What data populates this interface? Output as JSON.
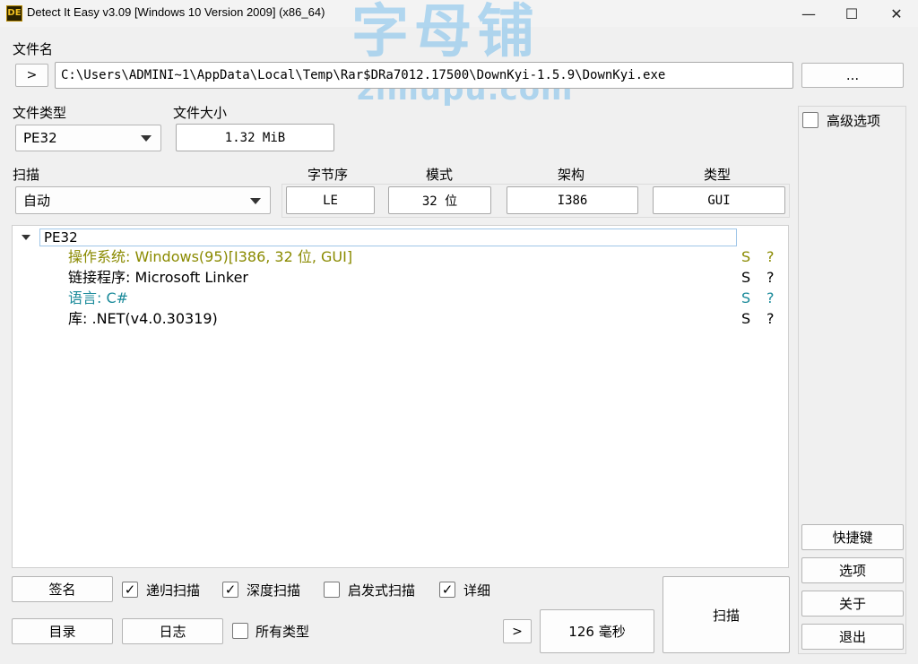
{
  "window": {
    "title": "Detect It Easy v3.09 [Windows 10 Version 2009] (x86_64)",
    "app_icon_text": "DE",
    "minimize_glyph": "—",
    "maximize_glyph": "☐",
    "close_glyph": "✕"
  },
  "watermark": {
    "line1": "字母铺",
    "line2": "zimupu.com"
  },
  "file": {
    "label": "文件名",
    "expand_glyph": ">",
    "path": "C:\\Users\\ADMINI~1\\AppData\\Local\\Temp\\Rar$DRa7012.17500\\DownKyi-1.5.9\\DownKyi.exe",
    "browse_label": "..."
  },
  "filetype": {
    "label": "文件类型",
    "value": "PE32"
  },
  "filesize": {
    "label": "文件大小",
    "value": "1.32 MiB"
  },
  "scan": {
    "label": "扫描",
    "value": "自动"
  },
  "info": {
    "endian_label": "字节序",
    "endian_value": "LE",
    "mode_label": "模式",
    "mode_value": "32 位",
    "arch_label": "架构",
    "arch_value": "I386",
    "type_label": "类型",
    "type_value": "GUI"
  },
  "advanced": {
    "label": "高级选项",
    "checked": false
  },
  "result": {
    "root": "PE32",
    "rows": [
      {
        "text": "操作系统: Windows(95)[I386, 32 位, GUI]",
        "s": "S",
        "q": "?",
        "color": "#8a8a00"
      },
      {
        "text": "链接程序: Microsoft Linker",
        "s": "S",
        "q": "?",
        "color": "#000000"
      },
      {
        "text": "语言: C#",
        "s": "S",
        "q": "?",
        "color": "#1a8a9a"
      },
      {
        "text": "库: .NET(v4.0.30319)",
        "s": "S",
        "q": "?",
        "color": "#000000"
      }
    ]
  },
  "bottom": {
    "signature_label": "签名",
    "recursive_label": "递归扫描",
    "recursive_checked": true,
    "deep_label": "深度扫描",
    "deep_checked": true,
    "heuristic_label": "启发式扫描",
    "heuristic_checked": false,
    "verbose_label": "详细",
    "verbose_checked": true,
    "dir_label": "目录",
    "log_label": "日志",
    "alltypes_label": "所有类型",
    "alltypes_checked": false,
    "next_glyph": ">",
    "time_label": "126 毫秒",
    "scan_label": "扫描"
  },
  "side": {
    "shortcuts_label": "快捷键",
    "options_label": "选项",
    "about_label": "关于",
    "exit_label": "退出"
  },
  "colors": {
    "check_mark": "✓"
  }
}
